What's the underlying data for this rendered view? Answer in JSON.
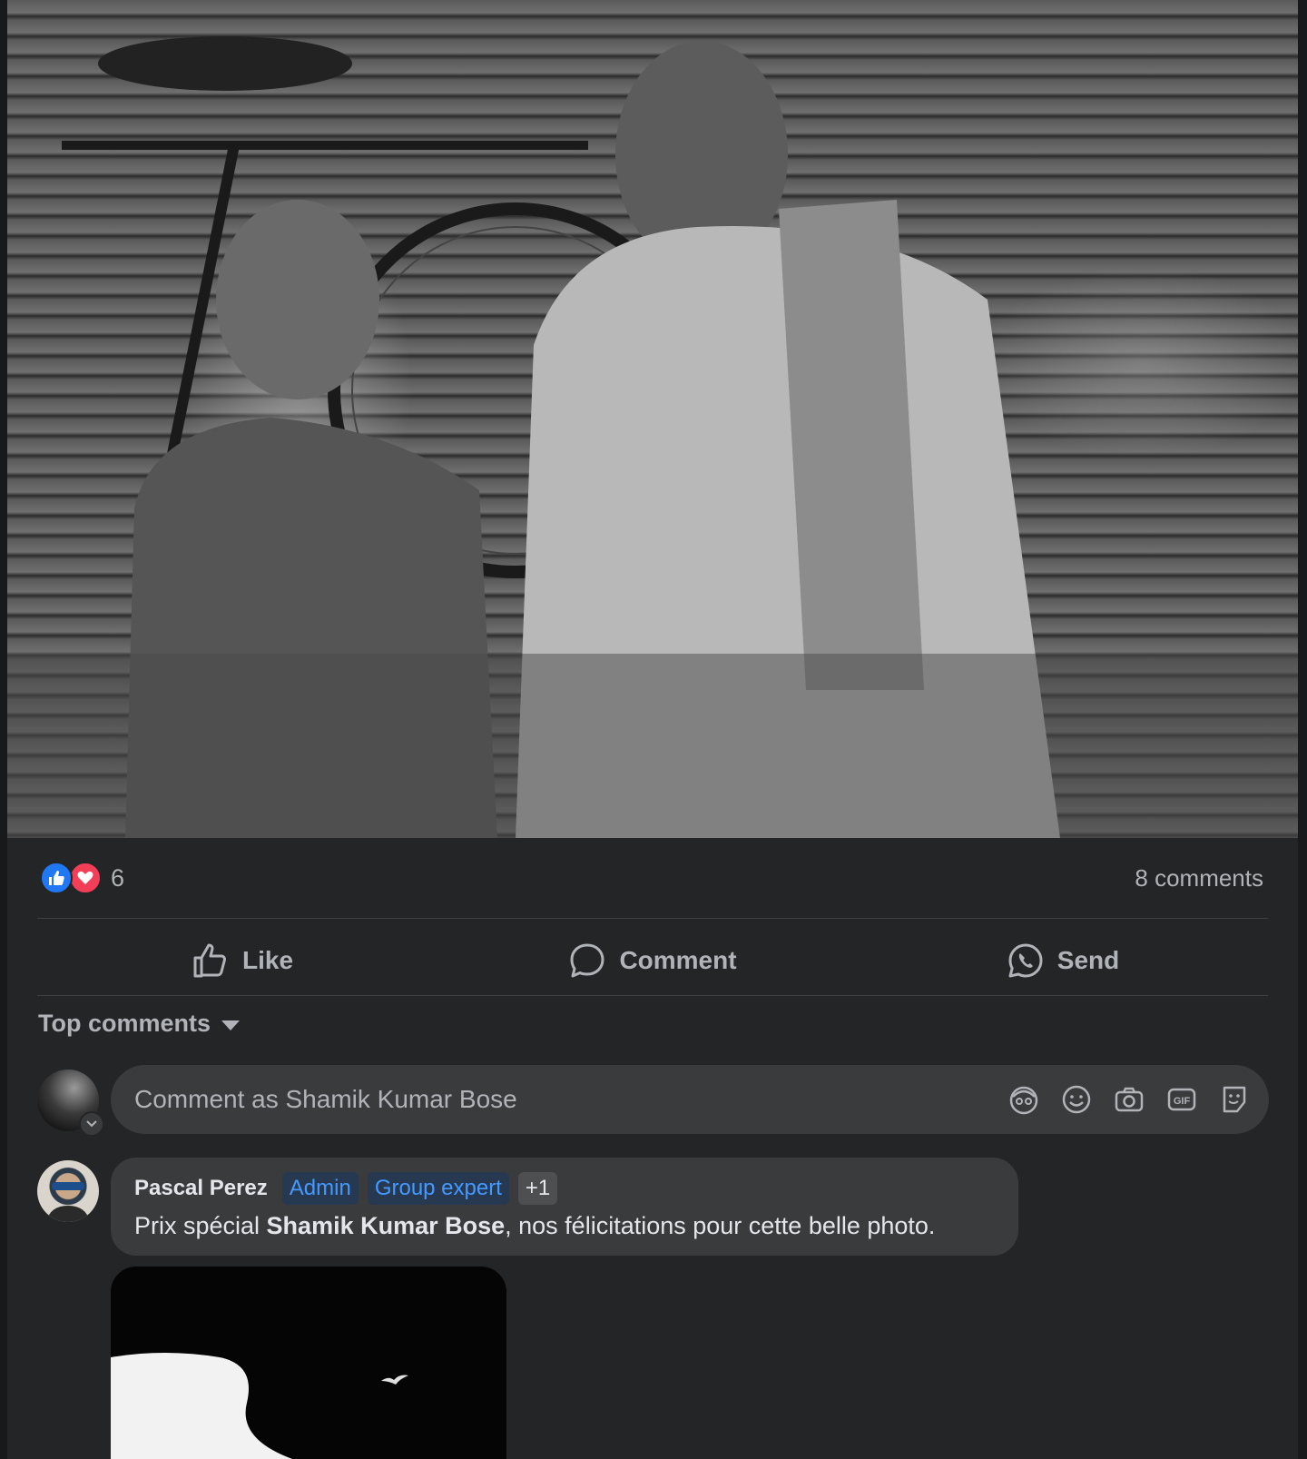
{
  "reactions": {
    "count": "6",
    "types": [
      "like",
      "love"
    ]
  },
  "comments_count": "8 comments",
  "actions": {
    "like": "Like",
    "comment": "Comment",
    "send": "Send"
  },
  "sort": {
    "label": "Top comments"
  },
  "composer": {
    "placeholder": "Comment as Shamik Kumar Bose",
    "tools": [
      "avatar-sticker-icon",
      "emoji-icon",
      "camera-icon",
      "gif-icon",
      "sticker-icon"
    ]
  },
  "comment": {
    "author": "Pascal Perez",
    "badges": [
      "Admin",
      "Group expert",
      "+1"
    ],
    "text_before": "Prix spécial ",
    "mention": "Shamik Kumar Bose",
    "text_after": ", nos félicitations pour cette belle photo."
  },
  "colors": {
    "surface": "#242526",
    "input": "#3a3b3c",
    "secondary_text": "#b0b3b8",
    "badge_text": "#4599ff",
    "like_blue": "#2078f4",
    "love_red": "#f33e58"
  }
}
